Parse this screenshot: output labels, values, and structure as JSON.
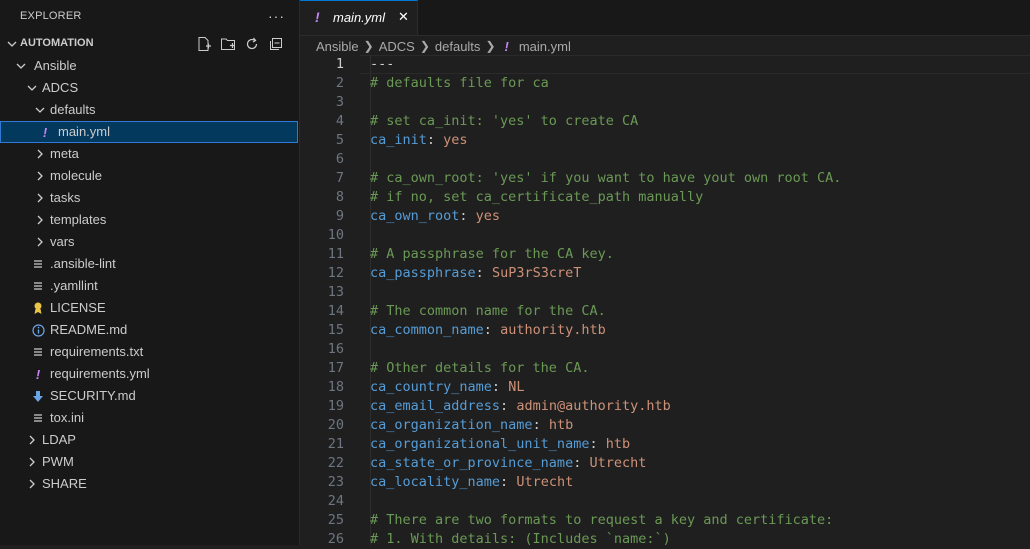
{
  "explorer": {
    "title": "EXPLORER",
    "more": "···",
    "root": "AUTOMATION",
    "tree": [
      {
        "label": "Ansible",
        "depth": 1,
        "type": "folder",
        "open": true
      },
      {
        "label": "ADCS",
        "depth": 2,
        "type": "folder",
        "open": true
      },
      {
        "label": "defaults",
        "depth": 3,
        "type": "folder",
        "open": true
      },
      {
        "label": "main.yml",
        "depth": 4,
        "type": "yaml",
        "selected": true
      },
      {
        "label": "meta",
        "depth": 3,
        "type": "folder",
        "open": false
      },
      {
        "label": "molecule",
        "depth": 3,
        "type": "folder",
        "open": false
      },
      {
        "label": "tasks",
        "depth": 3,
        "type": "folder",
        "open": false
      },
      {
        "label": "templates",
        "depth": 3,
        "type": "folder",
        "open": false
      },
      {
        "label": "vars",
        "depth": 3,
        "type": "folder",
        "open": false
      },
      {
        "label": ".ansible-lint",
        "depth": 3,
        "type": "lines"
      },
      {
        "label": ".yamllint",
        "depth": 3,
        "type": "lines"
      },
      {
        "label": "LICENSE",
        "depth": 3,
        "type": "license"
      },
      {
        "label": "README.md",
        "depth": 3,
        "type": "info"
      },
      {
        "label": "requirements.txt",
        "depth": 3,
        "type": "lines"
      },
      {
        "label": "requirements.yml",
        "depth": 3,
        "type": "yaml"
      },
      {
        "label": "SECURITY.md",
        "depth": 3,
        "type": "download"
      },
      {
        "label": "tox.ini",
        "depth": 3,
        "type": "lines"
      },
      {
        "label": "LDAP",
        "depth": 2,
        "type": "folder",
        "open": false
      },
      {
        "label": "PWM",
        "depth": 2,
        "type": "folder",
        "open": false
      },
      {
        "label": "SHARE",
        "depth": 2,
        "type": "folder",
        "open": false
      }
    ]
  },
  "tab": {
    "label": "main.yml",
    "icon": "!",
    "close": "✕"
  },
  "breadcrumb": {
    "items": [
      "Ansible",
      "ADCS",
      "defaults"
    ],
    "file": "main.yml",
    "file_icon": "!"
  },
  "code": {
    "active_line": 1,
    "lines": [
      {
        "n": "1",
        "parts": [
          [
            "d",
            "---"
          ]
        ]
      },
      {
        "n": "2",
        "parts": [
          [
            "c",
            "# defaults file for ca"
          ]
        ]
      },
      {
        "n": "3",
        "parts": []
      },
      {
        "n": "4",
        "parts": [
          [
            "c",
            "# set ca_init: 'yes' to create CA"
          ]
        ]
      },
      {
        "n": "5",
        "parts": [
          [
            "k",
            "ca_init"
          ],
          [
            "p",
            ": "
          ],
          [
            "v",
            "yes"
          ]
        ]
      },
      {
        "n": "6",
        "parts": []
      },
      {
        "n": "7",
        "parts": [
          [
            "c",
            "# ca_own_root: 'yes' if you want to have yout own root CA."
          ]
        ]
      },
      {
        "n": "8",
        "parts": [
          [
            "c",
            "# if no, set ca_certificate_path manually"
          ]
        ]
      },
      {
        "n": "9",
        "parts": [
          [
            "k",
            "ca_own_root"
          ],
          [
            "p",
            ": "
          ],
          [
            "v",
            "yes"
          ]
        ]
      },
      {
        "n": "10",
        "parts": []
      },
      {
        "n": "11",
        "parts": [
          [
            "c",
            "# A passphrase for the CA key."
          ]
        ]
      },
      {
        "n": "12",
        "parts": [
          [
            "k",
            "ca_passphrase"
          ],
          [
            "p",
            ": "
          ],
          [
            "v",
            "SuP3rS3creT"
          ]
        ]
      },
      {
        "n": "13",
        "parts": []
      },
      {
        "n": "14",
        "parts": [
          [
            "c",
            "# The common name for the CA."
          ]
        ]
      },
      {
        "n": "15",
        "parts": [
          [
            "k",
            "ca_common_name"
          ],
          [
            "p",
            ": "
          ],
          [
            "v",
            "authority.htb"
          ]
        ]
      },
      {
        "n": "16",
        "parts": []
      },
      {
        "n": "17",
        "parts": [
          [
            "c",
            "# Other details for the CA."
          ]
        ]
      },
      {
        "n": "18",
        "parts": [
          [
            "k",
            "ca_country_name"
          ],
          [
            "p",
            ": "
          ],
          [
            "v",
            "NL"
          ]
        ]
      },
      {
        "n": "19",
        "parts": [
          [
            "k",
            "ca_email_address"
          ],
          [
            "p",
            ": "
          ],
          [
            "v",
            "admin@authority.htb"
          ]
        ]
      },
      {
        "n": "20",
        "parts": [
          [
            "k",
            "ca_organization_name"
          ],
          [
            "p",
            ": "
          ],
          [
            "v",
            "htb"
          ]
        ]
      },
      {
        "n": "21",
        "parts": [
          [
            "k",
            "ca_organizational_unit_name"
          ],
          [
            "p",
            ": "
          ],
          [
            "v",
            "htb"
          ]
        ]
      },
      {
        "n": "22",
        "parts": [
          [
            "k",
            "ca_state_or_province_name"
          ],
          [
            "p",
            ": "
          ],
          [
            "v",
            "Utrecht"
          ]
        ]
      },
      {
        "n": "23",
        "parts": [
          [
            "k",
            "ca_locality_name"
          ],
          [
            "p",
            ": "
          ],
          [
            "v",
            "Utrecht"
          ]
        ]
      },
      {
        "n": "24",
        "parts": []
      },
      {
        "n": "25",
        "parts": [
          [
            "c",
            "# There are two formats to request a key and certificate:"
          ]
        ]
      },
      {
        "n": "26",
        "parts": [
          [
            "c",
            "# 1. With details: (Includes `name:`)"
          ]
        ]
      }
    ]
  },
  "colors": {
    "accent": "#0078d4",
    "selection": "#04395e",
    "yaml_icon": "#c586f5",
    "key": "#569cd6",
    "string": "#ce9178",
    "comment": "#6a9955"
  }
}
